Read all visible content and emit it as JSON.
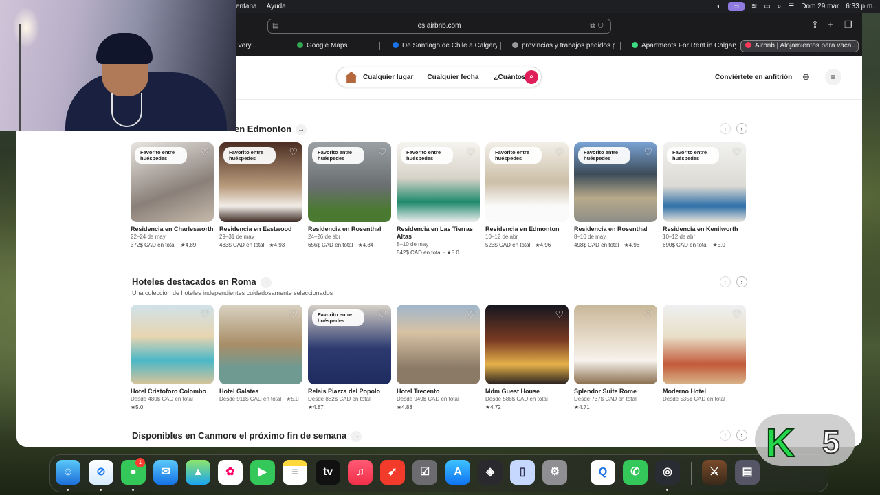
{
  "menubar": {
    "left": [
      "entana",
      "Ayuda"
    ],
    "right_date": "Dom 29 mar",
    "right_time": "6:33 p.m."
  },
  "browser": {
    "url": "es.airbnb.com",
    "tabs": [
      {
        "label": "Every...",
        "color": "#ffffff"
      },
      {
        "label": "Google Maps",
        "color": "#34a853"
      },
      {
        "label": "De Santiago de Chile a Calgary |...",
        "color": "#1a73e8"
      },
      {
        "label": "provincias y trabajos pedidos p...",
        "color": "#999999"
      },
      {
        "label": "Apartments For Rent in Calgary,...",
        "color": "#3ddc84"
      },
      {
        "label": "Airbnb | Alojamientos para vaca...",
        "color": "#ff385c"
      }
    ]
  },
  "header": {
    "place": "Cualquier lugar",
    "date": "Cualquier fecha",
    "guests": "¿Cuántos?",
    "host": "Conviértete en anfitrión"
  },
  "colors": {
    "brand": "#e01e5a"
  },
  "icons": {
    "search": "search-icon",
    "globe": "globe-icon",
    "menu": "menu-icon",
    "heart": "heart-icon"
  },
  "section1": {
    "title": "en Edmonton",
    "cards": [
      {
        "badge": "Favorito entre huéspedes",
        "title": "Residencia en Charlesworth",
        "dates": "22–24 de may",
        "price": "372$ CAD en total · ★4.89",
        "bg": "linear-gradient(160deg,#e8e4e0,#8a8079 60%,#c6b9ab)"
      },
      {
        "badge": "Favorito entre huéspedes",
        "title": "Residencia en Eastwood",
        "dates": "29–31 de may",
        "price": "483$ CAD en total · ★4.93",
        "bg": "linear-gradient(180deg,#4b2d22,#b89a7c 55%,#f2ede8 80%,#3a2a22)"
      },
      {
        "badge": "Favorito entre huéspedes",
        "title": "Residencia en Rosenthal",
        "dates": "24–26 de abr",
        "price": "656$ CAD en total · ★4.84",
        "bg": "linear-gradient(180deg,#9aa0a4,#6a6e70 55%,#4a7a32 85%)"
      },
      {
        "badge": "Favorito entre huéspedes",
        "title": "Residencia en Las Tierras Altas",
        "dates": "8–10 de may",
        "price": "542$ CAD en total · ★5.0",
        "bg": "linear-gradient(180deg,#f6f4ef,#d8d3c9 45%,#1f8a6c 75%,#eee)"
      },
      {
        "badge": "Favorito entre huéspedes",
        "title": "Residencia en Edmonton",
        "dates": "10–12 de abr",
        "price": "523$ CAD en total · ★4.96",
        "bg": "linear-gradient(180deg,#f2efe8,#cdbfa8 50%,#fafafa 80%)"
      },
      {
        "badge": "Favorito entre huéspedes",
        "title": "Residencia en Rosenthal",
        "dates": "8–10 de may",
        "price": "498$ CAD en total · ★4.96",
        "bg": "linear-gradient(180deg,#7aa3d4,#3d4c5a 40%,#b8aa8a 70%,#8d8d88)"
      },
      {
        "badge": "Favorito entre huéspedes",
        "title": "Residencia en Kenilworth",
        "dates": "10–12 de abr",
        "price": "690$ CAD en total · ★5.0",
        "bg": "linear-gradient(180deg,#f1f1ef,#dcdad4 55%,#2f6fa8 80%,#e8e4dc)"
      }
    ]
  },
  "section2": {
    "title": "Hoteles destacados en Roma",
    "subtitle": "Una colección de hoteles independientes cuidadosamente seleccionados",
    "cards": [
      {
        "badge": "",
        "title": "Hotel Cristoforo Colombo",
        "dates": "Desde 480$ CAD en total ·",
        "price": "★5.0",
        "bg": "linear-gradient(180deg,#cfe2ea,#e8d5b0 40%,#4bb7c7 70%,#d9c49a)"
      },
      {
        "badge": "",
        "title": "Hotel Galatea",
        "dates": "Desde 911$ CAD en total · ★5.0",
        "price": "",
        "bg": "linear-gradient(180deg,#d9d2c2,#a98e68 50%,#6e9a92 80%)"
      },
      {
        "badge": "Favorito entre huéspedes",
        "title": "Relais Piazza del Popolo",
        "dates": "Desde 882$ CAD en total ·",
        "price": "★4.87",
        "bg": "linear-gradient(180deg,#d8d2c8,#2c3a70 55%,#1e2b5e)"
      },
      {
        "badge": "",
        "title": "Hotel Trecento",
        "dates": "Desde 949$ CAD en total ·",
        "price": "★4.83",
        "bg": "linear-gradient(180deg,#9fb6cc,#d8c2a4 35%,#8a7a66 80%)"
      },
      {
        "badge": "",
        "title": "Mdm Guest House",
        "dates": "Desde 588$ CAD en total ·",
        "price": "★4.72",
        "bg": "linear-gradient(180deg,#14161f,#7a3a22 45%,#e6b24a 75%,#2a2220)"
      },
      {
        "badge": "",
        "title": "Splendor Suite Rome",
        "dates": "Desde 737$ CAD en total ·",
        "price": "★4.71",
        "bg": "linear-gradient(180deg,#c8b89a,#e8dccb 45%,#f6f2ec 70%,#8a6e4e)"
      },
      {
        "badge": "",
        "title": "Moderno Hotel",
        "dates": "Desde 535$ CAD en total",
        "price": "",
        "bg": "linear-gradient(180deg,#eef0f2,#e9dfc8 40%,#c25a3a 75%,#d9b48a)"
      }
    ]
  },
  "section3": {
    "title": "Disponibles en Canmore el próximo fin de semana"
  },
  "dock": {
    "badge": "1",
    "overlay_k": "K",
    "overlay_5": "5"
  }
}
